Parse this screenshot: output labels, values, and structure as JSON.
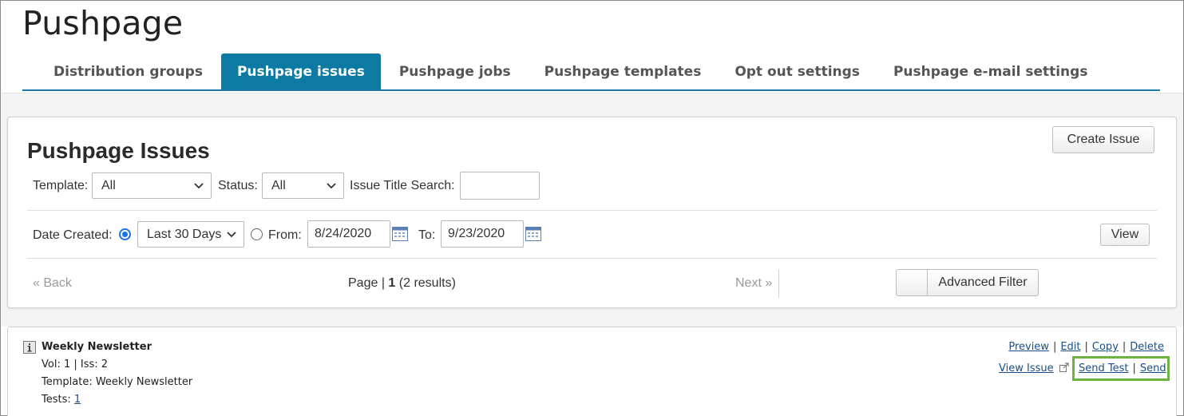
{
  "app": {
    "title": "Pushpage"
  },
  "tabs": [
    {
      "label": "Distribution groups",
      "active": false
    },
    {
      "label": "Pushpage issues",
      "active": true
    },
    {
      "label": "Pushpage jobs",
      "active": false
    },
    {
      "label": "Pushpage templates",
      "active": false
    },
    {
      "label": "Opt out settings",
      "active": false
    },
    {
      "label": "Pushpage e-mail settings",
      "active": false
    }
  ],
  "panel": {
    "title": "Pushpage Issues",
    "create_button": "Create Issue",
    "filters": {
      "template_label": "Template:",
      "template_value": "All",
      "status_label": "Status:",
      "status_value": "All",
      "search_label": "Issue Title Search:",
      "search_value": "",
      "date_created_label": "Date Created:",
      "date_range_value": "Last 30 Days",
      "from_label": "From:",
      "from_value": "8/24/2020",
      "to_label": "To:",
      "to_value": "9/23/2020",
      "view_button": "View",
      "date_mode": "range"
    },
    "pager": {
      "back": "« Back",
      "page_prefix": "Page |",
      "page_number": "1",
      "results": "(2 results)",
      "next": "Next »",
      "advanced_filter": "Advanced Filter"
    }
  },
  "issue": {
    "title": "Weekly Newsletter",
    "vol_iss": "Vol: 1 | Iss: 2",
    "template": "Template: Weekly Newsletter",
    "tests_label": "Tests:",
    "tests_value": "1",
    "actions": {
      "preview": "Preview",
      "edit": "Edit",
      "copy": "Copy",
      "delete": "Delete",
      "view_issue": "View Issue",
      "send_test": "Send Test",
      "send": "Send"
    },
    "info_icon": "info-icon",
    "external_icon": "external-link-icon"
  },
  "colors": {
    "accent": "#0d7aa3",
    "highlight": "#6cb33f",
    "link": "#1a4f8a"
  }
}
